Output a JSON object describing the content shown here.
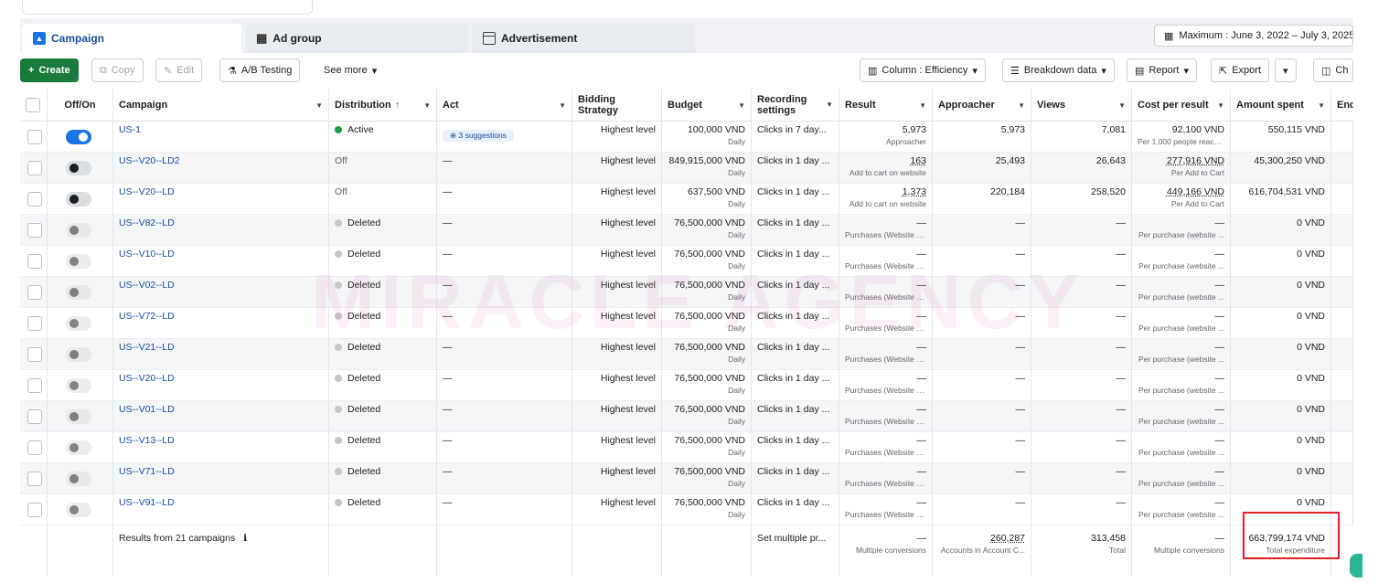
{
  "tabs": {
    "campaign": "Campaign",
    "ad_group": "Ad group",
    "advertisement": "Advertisement"
  },
  "date_range": "Maximum : June 3, 2022 – July 3, 2025",
  "toolbar": {
    "create": "Create",
    "copy": "Copy",
    "edit": "Edit",
    "ab_testing": "A/B Testing",
    "see_more": "See more",
    "column": "Column : Efficiency",
    "breakdown": "Breakdown data",
    "report": "Report",
    "export": "Export",
    "chart": "Ch"
  },
  "columns": {
    "off_on": "Off/On",
    "campaign": "Campaign",
    "distribution": "Distribution",
    "act": "Act",
    "bidding": "Bidding Strategy",
    "budget": "Budget",
    "recording": "Recording settings",
    "result": "Result",
    "approacher": "Approacher",
    "views": "Views",
    "cost": "Cost per result",
    "spent": "Amount spent",
    "end": "End"
  },
  "rows": [
    {
      "toggle": "on",
      "name": "US-1",
      "status": "Active",
      "status_color": "#1a9e47",
      "act": "3 suggestions",
      "bidding": "Highest level",
      "budget": "100,000 VND",
      "budget_sub": "Daily",
      "recording": "Clicks in 7 day...",
      "result": "5,973",
      "result_sub": "Approacher",
      "approacher": "5,973",
      "views": "7,081",
      "cost": "92,100 VND",
      "cost_sub": "Per 1,000 people reach...",
      "spent": "550,115 VND"
    },
    {
      "toggle": "off",
      "name": "US--V20--LD2",
      "status": "Off",
      "status_color": "",
      "act": "—",
      "bidding": "Highest level",
      "budget": "849,915,000 VND",
      "budget_sub": "Daily",
      "recording": "Clicks in 1 day ...",
      "result": "163",
      "result_sub": "Add to cart on website",
      "approacher": "25,493",
      "views": "26,643",
      "cost": "277,916 VND",
      "cost_sub": "Per Add to Cart",
      "spent": "45,300,250 VND"
    },
    {
      "toggle": "off",
      "name": "US--V20--LD",
      "status": "Off",
      "status_color": "",
      "act": "—",
      "bidding": "Highest level",
      "budget": "637,500 VND",
      "budget_sub": "Daily",
      "recording": "Clicks in 1 day ...",
      "result": "1,373",
      "result_sub": "Add to cart on website",
      "approacher": "220,184",
      "views": "258,520",
      "cost": "449,166 VND",
      "cost_sub": "Per Add to Cart",
      "spent": "616,704,531 VND"
    },
    {
      "toggle": "del",
      "name": "US--V82--LD",
      "status": "Deleted",
      "status_color": "#c4c7cc",
      "act": "—",
      "bidding": "Highest level",
      "budget": "76,500,000 VND",
      "budget_sub": "Daily",
      "recording": "Clicks in 1 day ...",
      "result": "—",
      "result_sub": "Purchases (Website an...",
      "approacher": "—",
      "views": "—",
      "cost": "—",
      "cost_sub": "Per purchase (website ...",
      "spent": "0 VND"
    },
    {
      "toggle": "del",
      "name": "US--V10--LD",
      "status": "Deleted",
      "status_color": "#c4c7cc",
      "act": "—",
      "bidding": "Highest level",
      "budget": "76,500,000 VND",
      "budget_sub": "Daily",
      "recording": "Clicks in 1 day ...",
      "result": "—",
      "result_sub": "Purchases (Website an...",
      "approacher": "—",
      "views": "—",
      "cost": "—",
      "cost_sub": "Per purchase (website ...",
      "spent": "0 VND"
    },
    {
      "toggle": "del",
      "name": "US--V02--LD",
      "status": "Deleted",
      "status_color": "#c4c7cc",
      "act": "—",
      "bidding": "Highest level",
      "budget": "76,500,000 VND",
      "budget_sub": "Daily",
      "recording": "Clicks in 1 day ...",
      "result": "—",
      "result_sub": "Purchases (Website an...",
      "approacher": "—",
      "views": "—",
      "cost": "—",
      "cost_sub": "Per purchase (website ...",
      "spent": "0 VND"
    },
    {
      "toggle": "del",
      "name": "US--V72--LD",
      "status": "Deleted",
      "status_color": "#c4c7cc",
      "act": "—",
      "bidding": "Highest level",
      "budget": "76,500,000 VND",
      "budget_sub": "Daily",
      "recording": "Clicks in 1 day ...",
      "result": "—",
      "result_sub": "Purchases (Website an...",
      "approacher": "—",
      "views": "—",
      "cost": "—",
      "cost_sub": "Per purchase (website ...",
      "spent": "0 VND"
    },
    {
      "toggle": "del",
      "name": "US--V21--LD",
      "status": "Deleted",
      "status_color": "#c4c7cc",
      "act": "—",
      "bidding": "Highest level",
      "budget": "76,500,000 VND",
      "budget_sub": "Daily",
      "recording": "Clicks in 1 day ...",
      "result": "—",
      "result_sub": "Purchases (Website an...",
      "approacher": "—",
      "views": "—",
      "cost": "—",
      "cost_sub": "Per purchase (website ...",
      "spent": "0 VND"
    },
    {
      "toggle": "del",
      "name": "US--V20--LD",
      "status": "Deleted",
      "status_color": "#c4c7cc",
      "act": "—",
      "bidding": "Highest level",
      "budget": "76,500,000 VND",
      "budget_sub": "Daily",
      "recording": "Clicks in 1 day ...",
      "result": "—",
      "result_sub": "Purchases (Website an...",
      "approacher": "—",
      "views": "—",
      "cost": "—",
      "cost_sub": "Per purchase (website ...",
      "spent": "0 VND"
    },
    {
      "toggle": "del",
      "name": "US--V01--LD",
      "status": "Deleted",
      "status_color": "#c4c7cc",
      "act": "—",
      "bidding": "Highest level",
      "budget": "76,500,000 VND",
      "budget_sub": "Daily",
      "recording": "Clicks in 1 day ...",
      "result": "—",
      "result_sub": "Purchases (Website an...",
      "approacher": "—",
      "views": "—",
      "cost": "—",
      "cost_sub": "Per purchase (website ...",
      "spent": "0 VND"
    },
    {
      "toggle": "del",
      "name": "US--V13--LD",
      "status": "Deleted",
      "status_color": "#c4c7cc",
      "act": "—",
      "bidding": "Highest level",
      "budget": "76,500,000 VND",
      "budget_sub": "Daily",
      "recording": "Clicks in 1 day ...",
      "result": "—",
      "result_sub": "Purchases (Website an...",
      "approacher": "—",
      "views": "—",
      "cost": "—",
      "cost_sub": "Per purchase (website ...",
      "spent": "0 VND"
    },
    {
      "toggle": "del",
      "name": "US--V71--LD",
      "status": "Deleted",
      "status_color": "#c4c7cc",
      "act": "—",
      "bidding": "Highest level",
      "budget": "76,500,000 VND",
      "budget_sub": "Daily",
      "recording": "Clicks in 1 day ...",
      "result": "—",
      "result_sub": "Purchases (Website an...",
      "approacher": "—",
      "views": "—",
      "cost": "—",
      "cost_sub": "Per purchase (website ...",
      "spent": "0 VND"
    },
    {
      "toggle": "del",
      "name": "US--V91--LD",
      "status": "Deleted",
      "status_color": "#c4c7cc",
      "act": "—",
      "bidding": "Highest level",
      "budget": "76,500,000 VND",
      "budget_sub": "Daily",
      "recording": "Clicks in 1 day ...",
      "result": "—",
      "result_sub": "Purchases (Website an...",
      "approacher": "—",
      "views": "—",
      "cost": "—",
      "cost_sub": "Per purchase (website ...",
      "spent": "0 VND"
    }
  ],
  "footer": {
    "label": "Results from 21 campaigns",
    "recording": "Set multiple pr...",
    "result": "—",
    "result_sub": "Multiple conversions",
    "approacher": "260,287",
    "approacher_sub": "Accounts in Account C...",
    "views": "313,458",
    "views_sub": "Total",
    "cost": "—",
    "cost_sub": "Multiple conversions",
    "spent": "663,799,174 VND",
    "spent_sub": "Total expenditure"
  },
  "watermark": "MIRACLE AGENCY",
  "colors": {
    "accent": "#1b74e4",
    "create": "#1a7a3c",
    "highlight": "#e21f26"
  }
}
